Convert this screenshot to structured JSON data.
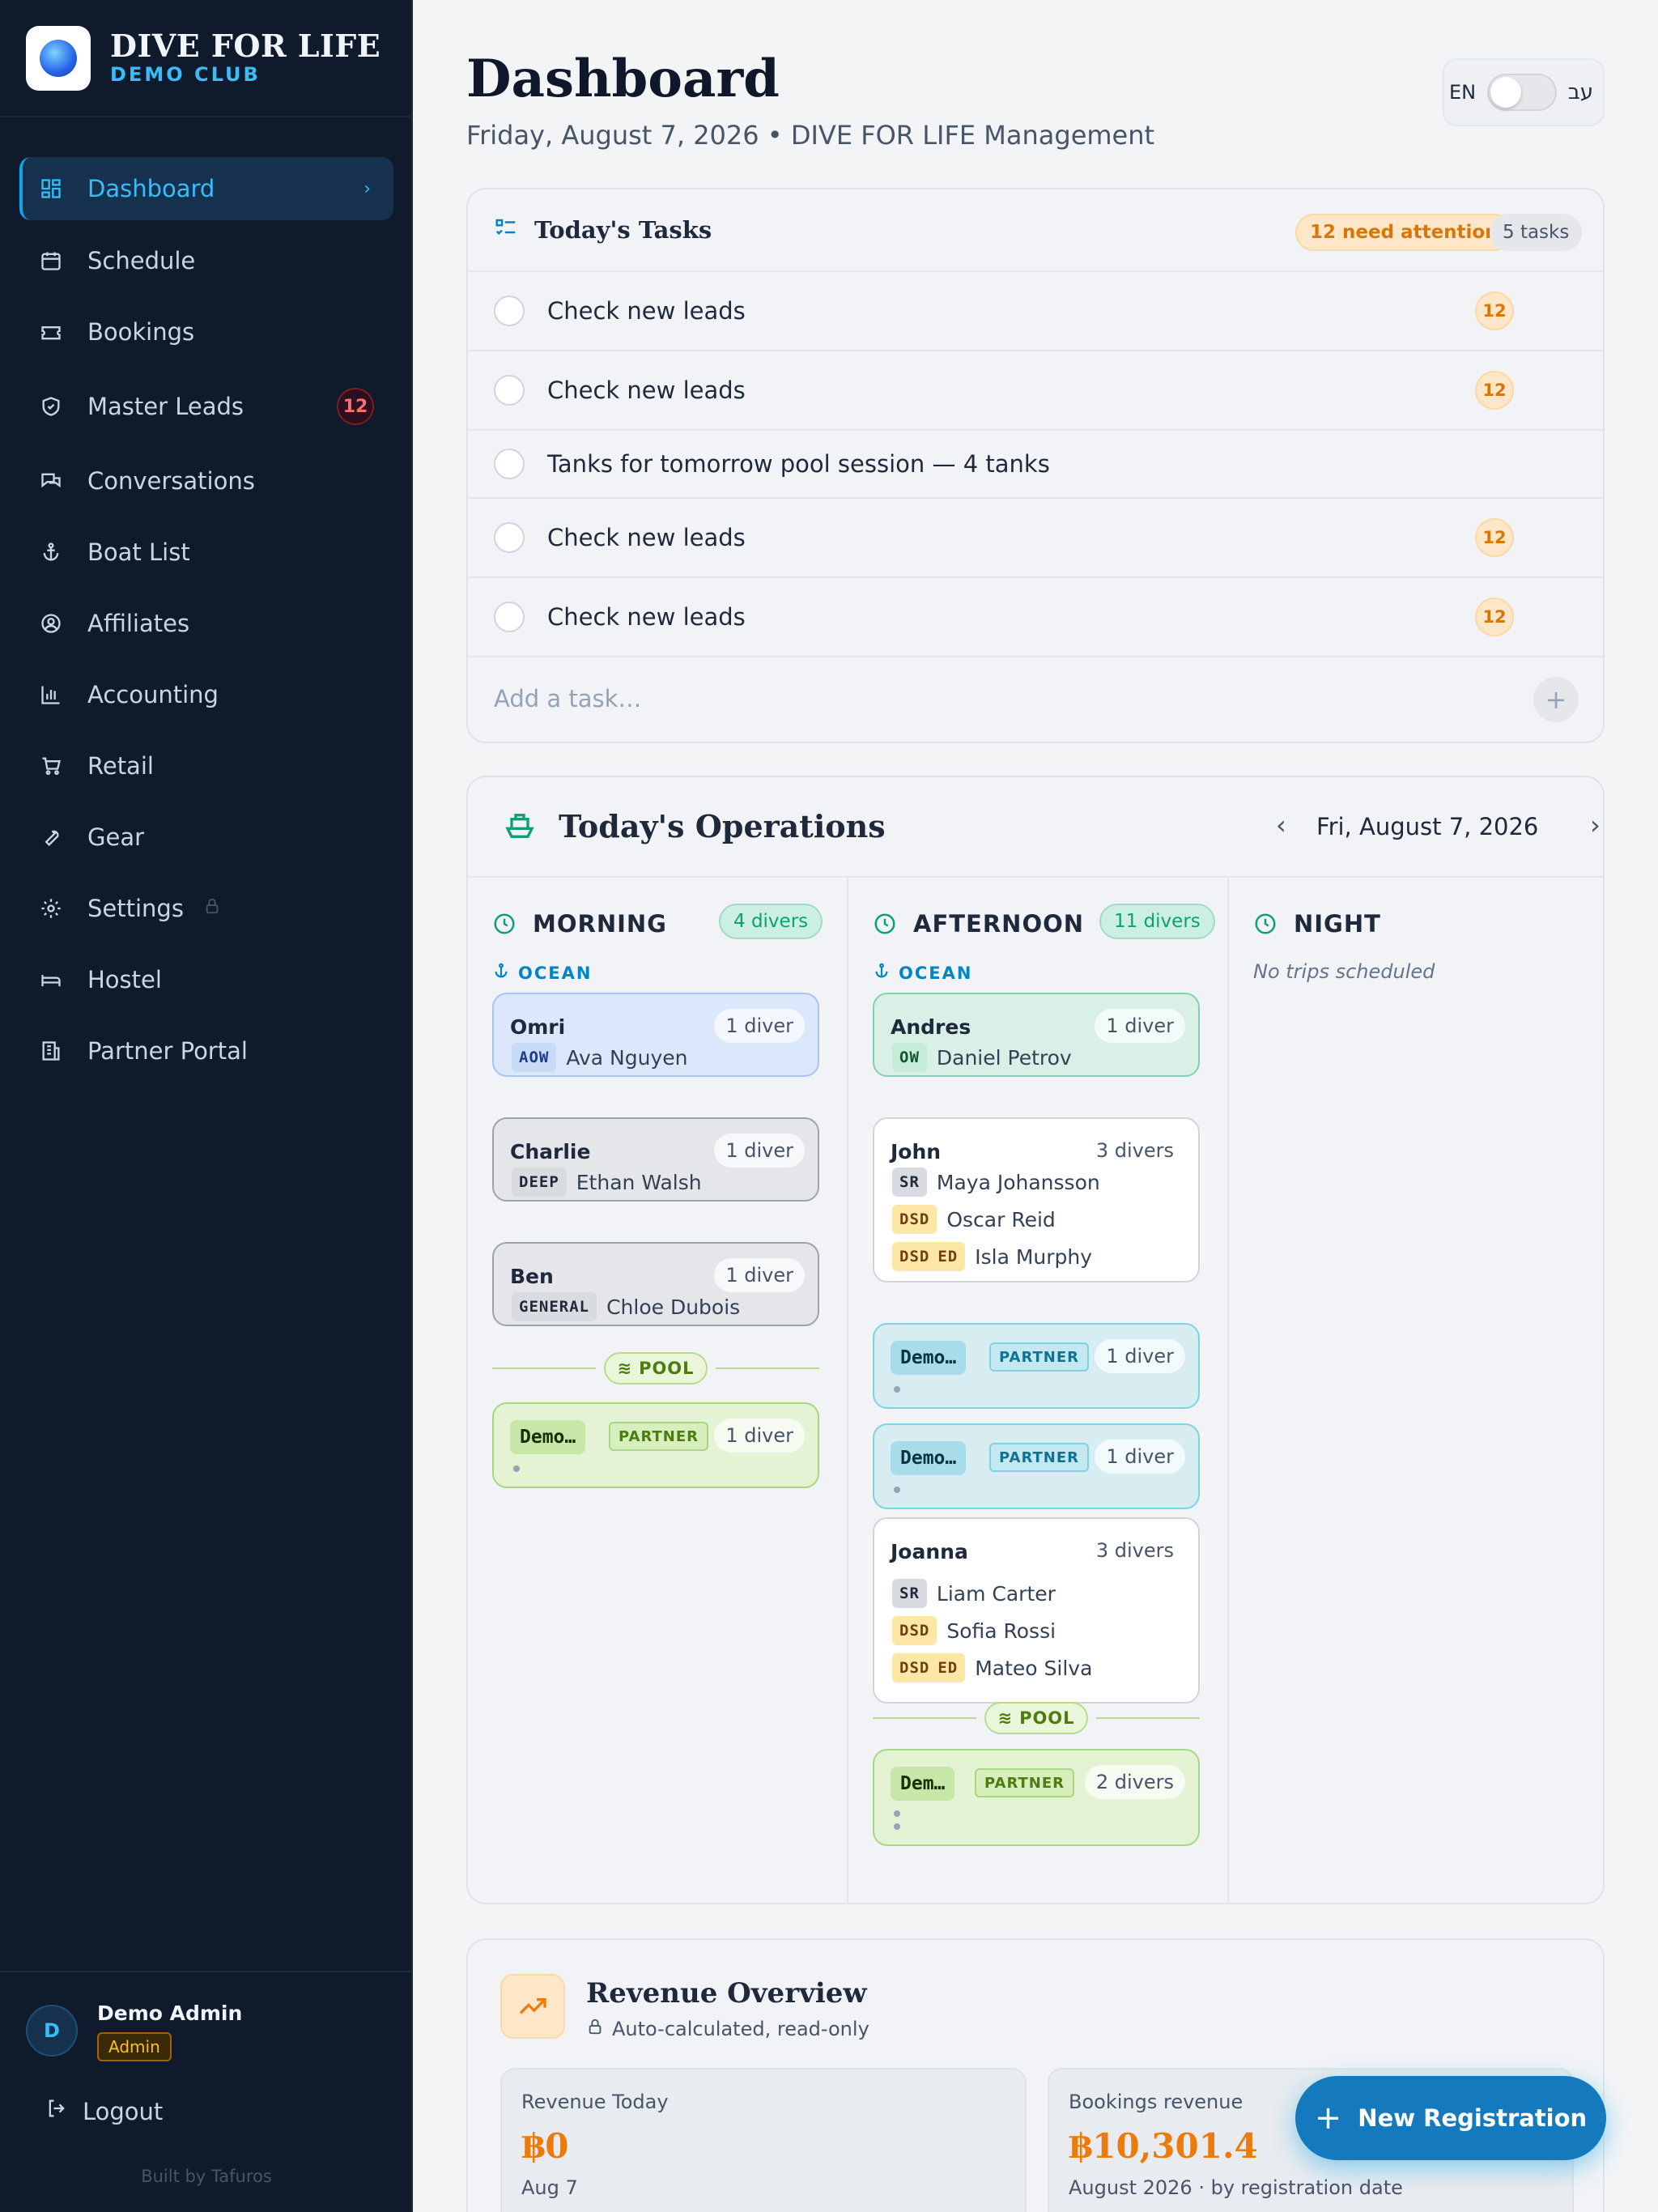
{
  "brand": {
    "title": "DIVE FOR LIFE",
    "subtitle": "DEMO CLUB"
  },
  "sidebar": {
    "items": [
      {
        "label": "Dashboard",
        "icon": "dashboard-icon",
        "active": true
      },
      {
        "label": "Schedule",
        "icon": "calendar-icon"
      },
      {
        "label": "Bookings",
        "icon": "ticket-icon"
      },
      {
        "label": "Master Leads",
        "icon": "shield-icon",
        "badge": "12"
      },
      {
        "label": "Conversations",
        "icon": "chat-icon"
      },
      {
        "label": "Boat List",
        "icon": "anchor-icon"
      },
      {
        "label": "Affiliates",
        "icon": "user-circle-icon"
      },
      {
        "label": "Accounting",
        "icon": "bar-chart-icon"
      },
      {
        "label": "Retail",
        "icon": "cart-icon"
      },
      {
        "label": "Gear",
        "icon": "wrench-icon"
      },
      {
        "label": "Settings",
        "icon": "gear-icon",
        "locked": true
      },
      {
        "label": "Hostel",
        "icon": "bed-icon"
      },
      {
        "label": "Partner Portal",
        "icon": "building-icon"
      }
    ]
  },
  "user": {
    "initial": "D",
    "name": "Demo Admin",
    "role": "Admin",
    "logout": "Logout",
    "built_by": "Built by Tafuros"
  },
  "header": {
    "title": "Dashboard",
    "subtitle": "Friday, August 7, 2026 • DIVE FOR LIFE Management",
    "lang_en": "EN",
    "lang_he": "עב"
  },
  "tasks": {
    "title": "Today's Tasks",
    "attention": "12 need attention",
    "count": "5 tasks",
    "placeholder": "Add a task…",
    "items": [
      {
        "text": "Check new leads",
        "badge": "12"
      },
      {
        "text": "Check new leads",
        "badge": "12"
      },
      {
        "text": "Tanks for tomorrow pool session — 4 tanks",
        "badge": ""
      },
      {
        "text": "Check new leads",
        "badge": "12"
      },
      {
        "text": "Check new leads",
        "badge": "12"
      }
    ]
  },
  "operations": {
    "title": "Today's Operations",
    "date": "Fri, August 7, 2026",
    "morning": {
      "title": "MORNING",
      "divers": "4 divers",
      "ocean": "OCEAN",
      "pool": "POOL",
      "trips": [
        {
          "name": "Omri",
          "count": "1 diver",
          "divers": [
            {
              "tags": [
                "AOW"
              ],
              "name": "Ava Nguyen"
            }
          ]
        },
        {
          "name": "Charlie",
          "count": "1 diver",
          "divers": [
            {
              "tags": [
                "DEEP"
              ],
              "name": "Ethan Walsh"
            }
          ]
        },
        {
          "name": "Ben",
          "count": "1 diver",
          "divers": [
            {
              "tags": [
                "GENERAL"
              ],
              "name": "Chloe Dubois"
            }
          ]
        }
      ],
      "pool_trips": [
        {
          "name": "Demo…",
          "tag": "PARTNER",
          "count": "1 diver"
        }
      ]
    },
    "afternoon": {
      "title": "AFTERNOON",
      "divers": "11 divers",
      "ocean": "OCEAN",
      "pool": "POOL",
      "trips": [
        {
          "name": "Andres",
          "count": "1 diver",
          "divers": [
            {
              "tags": [
                "OW"
              ],
              "name": "Daniel Petrov"
            }
          ]
        },
        {
          "name": "John",
          "count": "3 divers",
          "divers": [
            {
              "tags": [
                "SR"
              ],
              "name": "Maya Johansson"
            },
            {
              "tags": [
                "DSD"
              ],
              "name": "Oscar Reid"
            },
            {
              "tags": [
                "DSD",
                "ED"
              ],
              "name": "Isla Murphy"
            }
          ]
        },
        {
          "name": "Demo…",
          "tag": "PARTNER",
          "count": "1 diver"
        },
        {
          "name": "Demo…",
          "tag": "PARTNER",
          "count": "1 diver"
        },
        {
          "name": "Joanna",
          "count": "3 divers",
          "divers": [
            {
              "tags": [
                "SR"
              ],
              "name": "Liam Carter"
            },
            {
              "tags": [
                "DSD"
              ],
              "name": "Sofia Rossi"
            },
            {
              "tags": [
                "DSD",
                "ED"
              ],
              "name": "Mateo Silva"
            }
          ]
        }
      ],
      "pool_trips": [
        {
          "name": "Dem…",
          "tag": "PARTNER",
          "count": "2 divers"
        }
      ]
    },
    "night": {
      "title": "NIGHT",
      "empty": "No trips scheduled"
    }
  },
  "revenue": {
    "title": "Revenue Overview",
    "subtitle": "Auto-calculated, read-only",
    "boxes": [
      {
        "label": "Revenue Today",
        "value": "฿0",
        "note": "Aug 7"
      },
      {
        "label": "Bookings revenue",
        "value": "฿10,301.4",
        "note": "August 2026 · by registration date"
      }
    ]
  },
  "fab": {
    "label": "New Registration"
  },
  "colors": {
    "sidebar_bg": "#0f1b2d",
    "accent": "#0ea5e9",
    "warning": "#d97706",
    "fab": "#1579bd"
  }
}
